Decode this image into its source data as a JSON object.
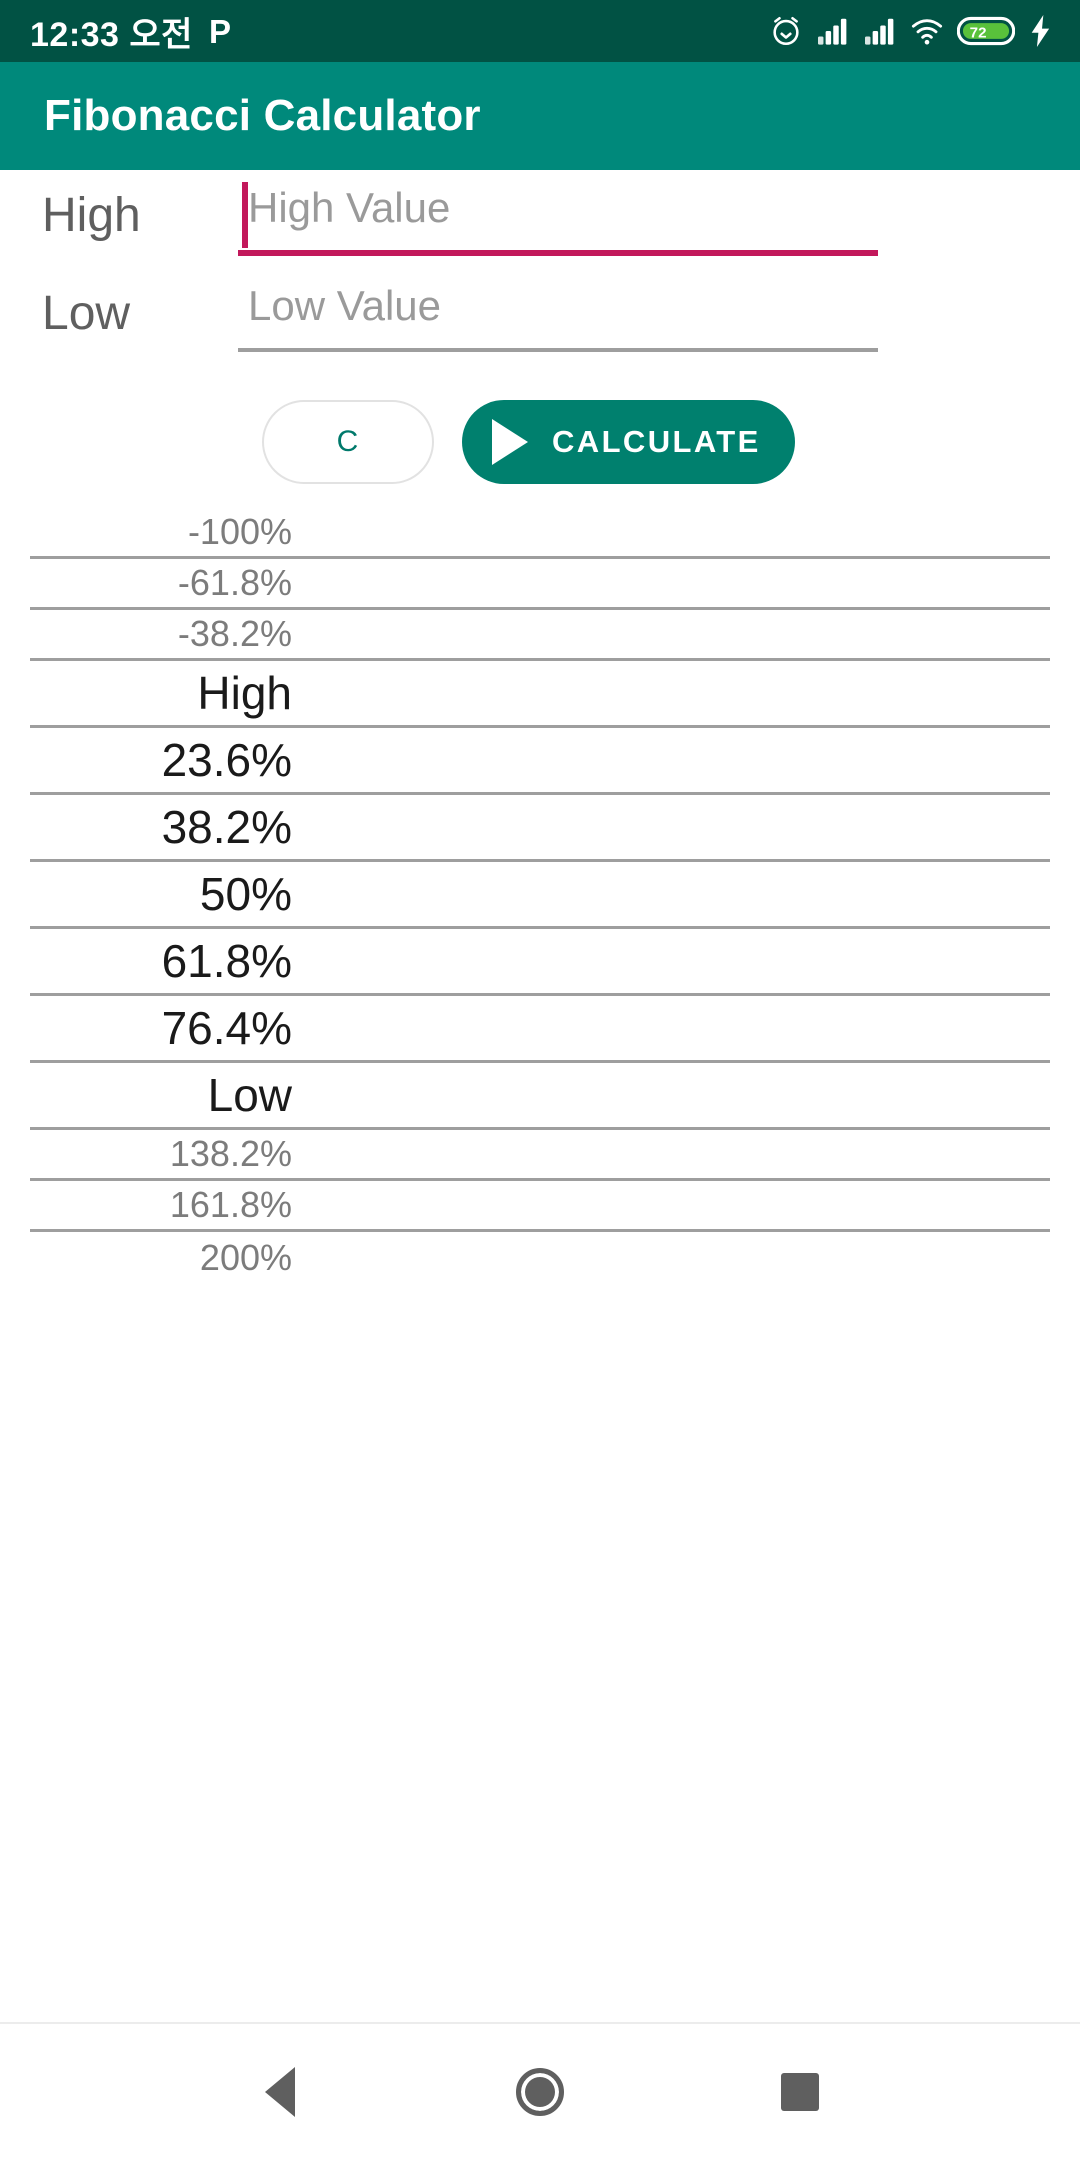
{
  "status_bar": {
    "time": "12:33 오전",
    "p_icon_label": "P",
    "icons": [
      "alarm-icon",
      "signal-icon-1",
      "signal-icon-2",
      "wifi-icon",
      "battery-icon",
      "charging-bolt-icon"
    ],
    "battery_level": "72",
    "background_color": "#015244"
  },
  "app_bar": {
    "title": "Fibonacci Calculator",
    "background_color": "#00897B"
  },
  "form": {
    "high": {
      "label": "High",
      "placeholder": "High Value",
      "value": "",
      "focused": true,
      "accent_color": "#C2185B"
    },
    "low": {
      "label": "Low",
      "placeholder": "Low Value",
      "value": "",
      "focused": false,
      "accent_color": "#9E9E9E"
    }
  },
  "buttons": {
    "clear_label": "C",
    "calculate_label": "CALCULATE",
    "calculate_icon": "play-icon",
    "primary_color": "#00806E",
    "clear_text_color": "#00796B"
  },
  "results": {
    "rows": [
      {
        "label": "-100%",
        "value": "",
        "style": "ext"
      },
      {
        "label": "-61.8%",
        "value": "",
        "style": "ext"
      },
      {
        "label": "-38.2%",
        "value": "",
        "style": "ext"
      },
      {
        "label": "High",
        "value": "",
        "style": "ret"
      },
      {
        "label": "23.6%",
        "value": "",
        "style": "ret"
      },
      {
        "label": "38.2%",
        "value": "",
        "style": "ret"
      },
      {
        "label": "50%",
        "value": "",
        "style": "ret"
      },
      {
        "label": "61.8%",
        "value": "",
        "style": "ret"
      },
      {
        "label": "76.4%",
        "value": "",
        "style": "ret"
      },
      {
        "label": "Low",
        "value": "",
        "style": "ret"
      },
      {
        "label": "138.2%",
        "value": "",
        "style": "ext"
      },
      {
        "label": "161.8%",
        "value": "",
        "style": "ext"
      },
      {
        "label": "200%",
        "value": "",
        "style": "ext"
      }
    ]
  },
  "nav_bar": {
    "back_label": "back-icon",
    "home_label": "home-icon",
    "recents_label": "recents-icon"
  }
}
